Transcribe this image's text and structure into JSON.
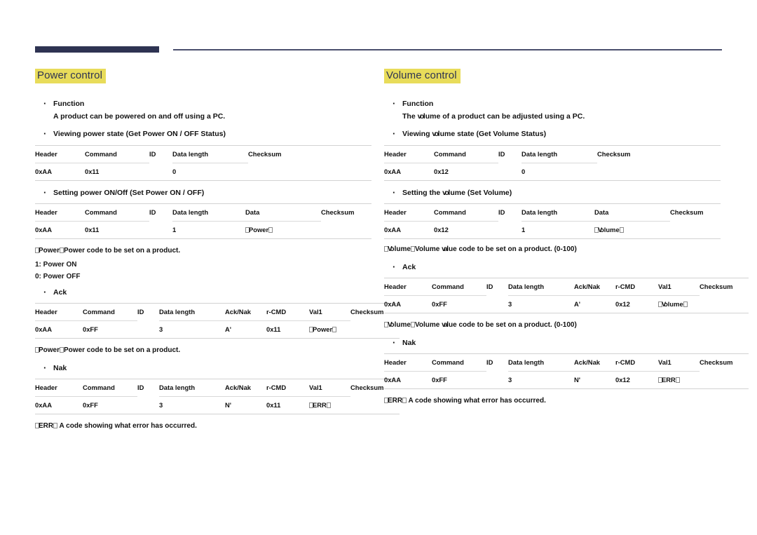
{
  "page": {
    "rule_color": "#2e3352",
    "highlight_color": "#e8dc5a",
    "title_color": "#2e3352"
  },
  "sections": [
    {
      "id": "power-control",
      "title": "Power control",
      "function_label": "Function",
      "function_text": "A product can be powered on and off using a PC.",
      "get_label": "Viewing power state (Get Power ON / OFF Status)",
      "get_table": {
        "headers": [
          "Header",
          "Command",
          "ID",
          "Data length",
          "Checksum"
        ],
        "row": [
          "0xAA",
          "0x11",
          "",
          "0",
          ""
        ]
      },
      "set_label": "Setting power ON/Off (Set Power ON / OFF)",
      "set_table": {
        "headers": [
          "Header",
          "Command",
          "ID",
          "Data length",
          "Data",
          "Checksum"
        ],
        "row": [
          "0xAA",
          "0x11",
          "",
          "1",
          "\"Power\"",
          ""
        ]
      },
      "set_note": "\"Power\": Power code to be set on a product.",
      "set_note_values": [
        "1: Power ON",
        "0: Power OFF"
      ],
      "ack_label": "Ack",
      "ack_table": {
        "headers": [
          "Header",
          "Command",
          "ID",
          "Data length",
          "Ack/Nak",
          "r-CMD",
          "Val1",
          "Checksum"
        ],
        "row": [
          "0xAA",
          "0xFF",
          "",
          "3",
          "'A'",
          "0x11",
          "\"Power\"",
          ""
        ]
      },
      "ack_note": "\"Power\": Power code to be set on a product.",
      "nak_label": "Nak",
      "nak_table": {
        "headers": [
          "Header",
          "Command",
          "ID",
          "Data length",
          "Ack/Nak",
          "r-CMD",
          "Val1",
          "Checksum"
        ],
        "row": [
          "0xAA",
          "0xFF",
          "",
          "3",
          "'N'",
          "0x11",
          "\"ERR\"",
          ""
        ]
      },
      "nak_note": "\"ERR\": A code showing what error has occurred."
    },
    {
      "id": "volume-control",
      "title": "Volume control",
      "function_label": "Function",
      "function_text": "The volume of a product can be adjusted using a PC.",
      "get_label": "Viewing volume state (Get Volume Status)",
      "get_table": {
        "headers": [
          "Header",
          "Command",
          "ID",
          "Data length",
          "Checksum"
        ],
        "row": [
          "0xAA",
          "0x12",
          "",
          "0",
          ""
        ]
      },
      "set_label": "Setting the volume (Set Volume)",
      "set_table": {
        "headers": [
          "Header",
          "Command",
          "ID",
          "Data length",
          "Data",
          "Checksum"
        ],
        "row": [
          "0xAA",
          "0x12",
          "",
          "1",
          "\"Volume\"",
          ""
        ]
      },
      "set_note": "\"Volume\": Volume value code to be set on a product. (0-100)",
      "set_note_values": [],
      "ack_label": "Ack",
      "ack_table": {
        "headers": [
          "Header",
          "Command",
          "ID",
          "Data length",
          "Ack/Nak",
          "r-CMD",
          "Val1",
          "Checksum"
        ],
        "row": [
          "0xAA",
          "0xFF",
          "",
          "3",
          "'A'",
          "0x12",
          "\"Volume\"",
          ""
        ]
      },
      "ack_note": "\"Volume\": Volume value code to be set on a product. (0-100)",
      "nak_label": "Nak",
      "nak_table": {
        "headers": [
          "Header",
          "Command",
          "ID",
          "Data length",
          "Ack/Nak",
          "r-CMD",
          "Val1",
          "Checksum"
        ],
        "row": [
          "0xAA",
          "0xFF",
          "",
          "3",
          "'N'",
          "0x12",
          "\"ERR\"",
          ""
        ]
      },
      "nak_note": "\"ERR\": A code showing what error has occurred."
    }
  ]
}
